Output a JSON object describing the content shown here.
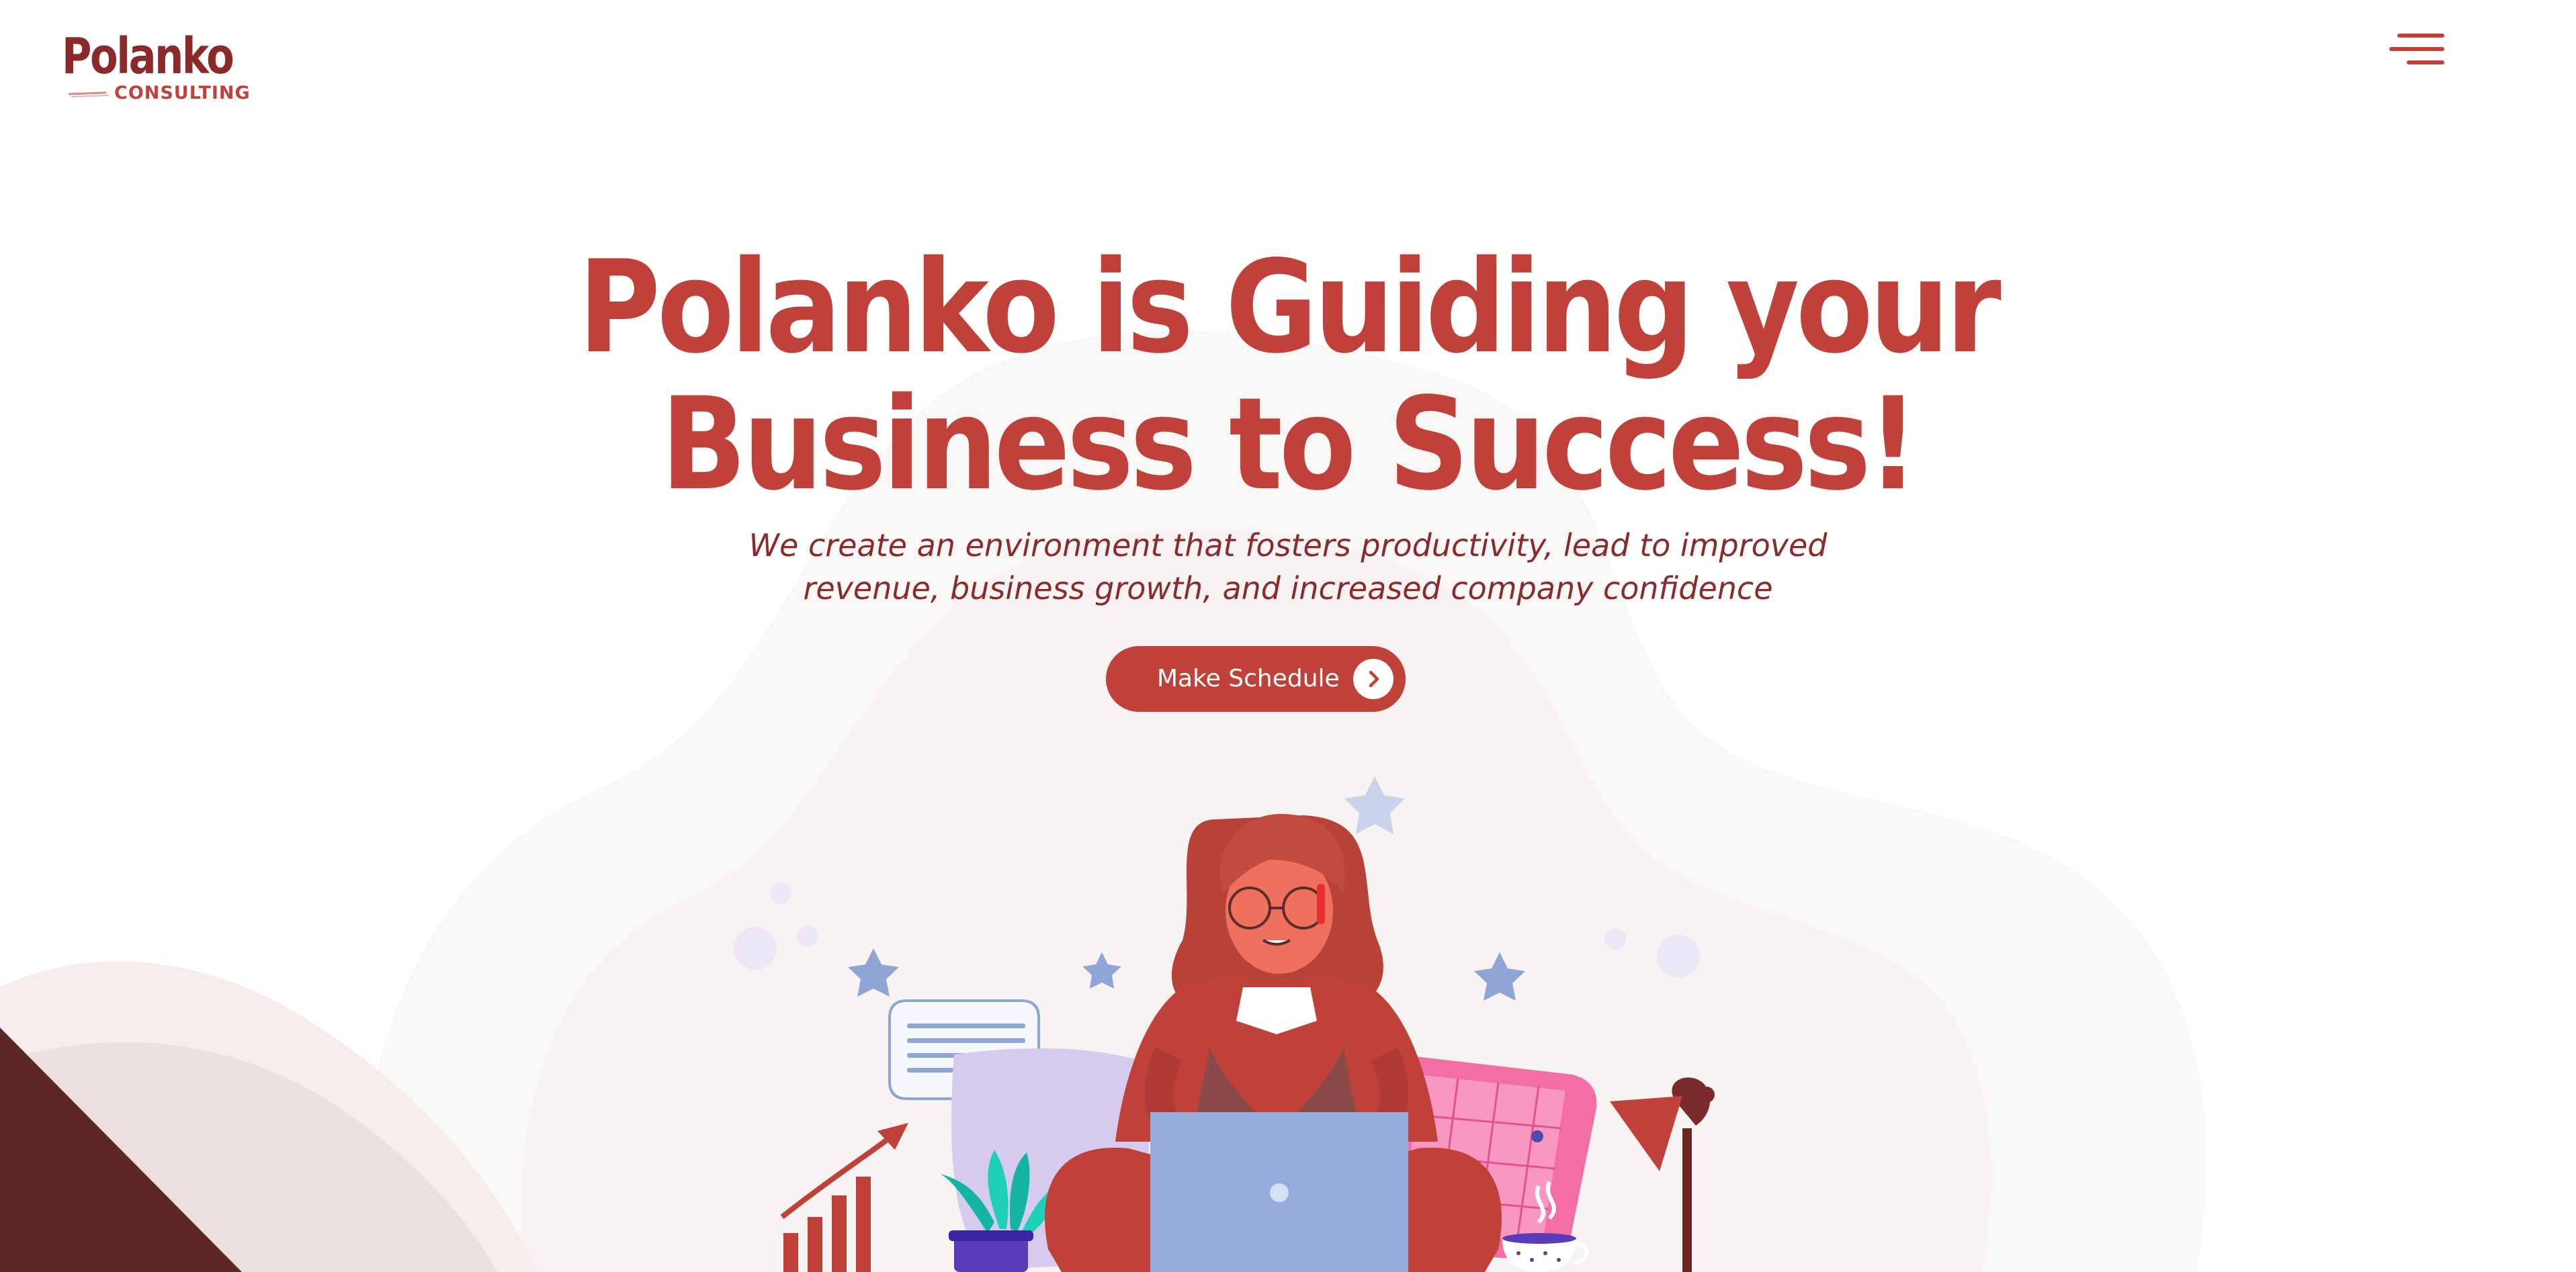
{
  "header": {
    "logo_name": "Polanko",
    "logo_sub": "CONSULTING",
    "menu_icon": "hamburger-menu-icon"
  },
  "hero": {
    "title_line1": "Polanko is Guiding your",
    "title_line2": "Business to Success!",
    "subtitle_line1": "We create an environment that fosters productivity, lead to improved",
    "subtitle_line2": "revenue, business growth, and increased company confidence",
    "cta_label": "Make Schedule",
    "cta_icon": "chevron-right-icon"
  },
  "illustration": {
    "subject": "woman-with-laptop-illustration",
    "icons": [
      "growth-chart-icon",
      "speech-bubble-icon",
      "potted-plant-icon",
      "laptop-icon",
      "coffee-cup-icon",
      "desk-lamp-icon",
      "star-icon"
    ]
  },
  "colors": {
    "brand_red": "#c0403a",
    "brand_dark": "#8b2a2b",
    "bg_blob": "#f8f6f5",
    "laptop_blue": "#8fa5d4"
  }
}
